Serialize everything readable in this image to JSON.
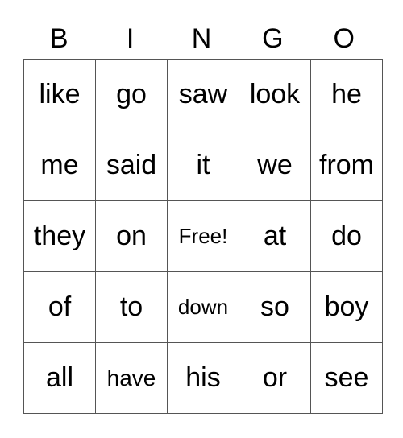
{
  "header": [
    "B",
    "I",
    "N",
    "G",
    "O"
  ],
  "rows": [
    [
      "like",
      "go",
      "saw",
      "look",
      "he"
    ],
    [
      "me",
      "said",
      "it",
      "we",
      "from"
    ],
    [
      "they",
      "on",
      "Free!",
      "at",
      "do"
    ],
    [
      "of",
      "to",
      "down",
      "so",
      "boy"
    ],
    [
      "all",
      "have",
      "his",
      "or",
      "see"
    ]
  ]
}
